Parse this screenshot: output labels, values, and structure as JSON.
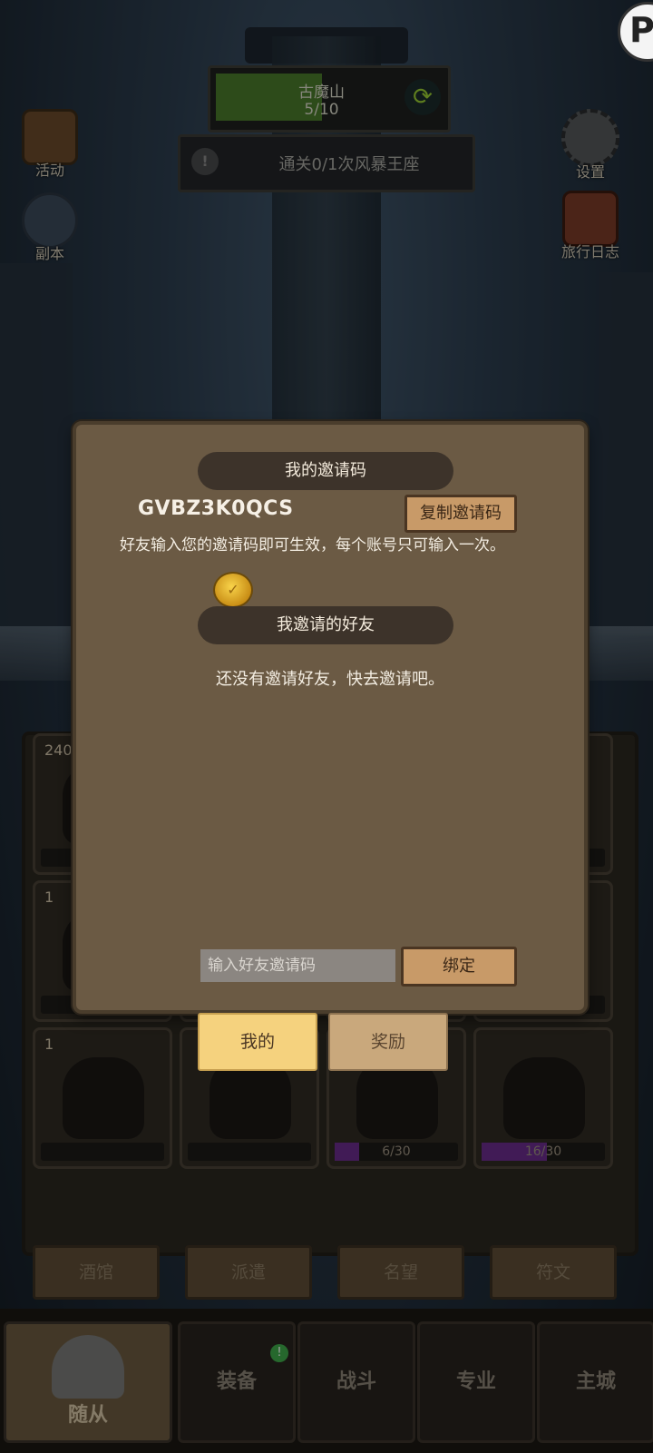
{
  "zone": {
    "name": "古魔山",
    "progress": "5/10",
    "progress_fraction": 0.5
  },
  "quest": {
    "text": "通关0/1次风暴王座"
  },
  "side_left": [
    {
      "label": "活动"
    },
    {
      "label": "副本"
    }
  ],
  "side_right": [
    {
      "label": "设置"
    },
    {
      "label": "旅行日志"
    }
  ],
  "roster": {
    "cards": [
      {
        "count": "240",
        "bar": ""
      },
      {
        "count": "",
        "bar": ""
      },
      {
        "count": "",
        "bar": ""
      },
      {
        "count": "",
        "bar": ""
      },
      {
        "count": "1",
        "bar": ""
      },
      {
        "count": "",
        "bar": ""
      },
      {
        "count": "",
        "bar": ""
      },
      {
        "count": "",
        "bar": ""
      },
      {
        "count": "1",
        "bar": ""
      },
      {
        "count": "",
        "bar": ""
      },
      {
        "count": "",
        "bar": "6/30",
        "fill": 0.2
      },
      {
        "count": "",
        "bar": "16/30",
        "fill": 0.53
      }
    ]
  },
  "sub_tabs": [
    "酒馆",
    "派遣",
    "名望",
    "符文"
  ],
  "nav": {
    "items": [
      "随从",
      "装备",
      "战斗",
      "专业",
      "主城"
    ],
    "badge": "!"
  },
  "modal": {
    "my_code_title": "我的邀请码",
    "code": "GVBZ3K0QCS",
    "copy_label": "复制邀请码",
    "description": "好友输入您的邀请码即可生效，每个账号只可输入一次。",
    "friends_title": "我邀请的好友",
    "no_friends": "还没有邀请好友，快去邀请吧。",
    "input_placeholder": "输入好友邀请码",
    "bind_label": "绑定",
    "tabs": [
      "我的",
      "奖励"
    ]
  },
  "colors": {
    "accent_tab": "#f5d27e",
    "button": "#c89a68",
    "panel": "#6b5a44"
  }
}
